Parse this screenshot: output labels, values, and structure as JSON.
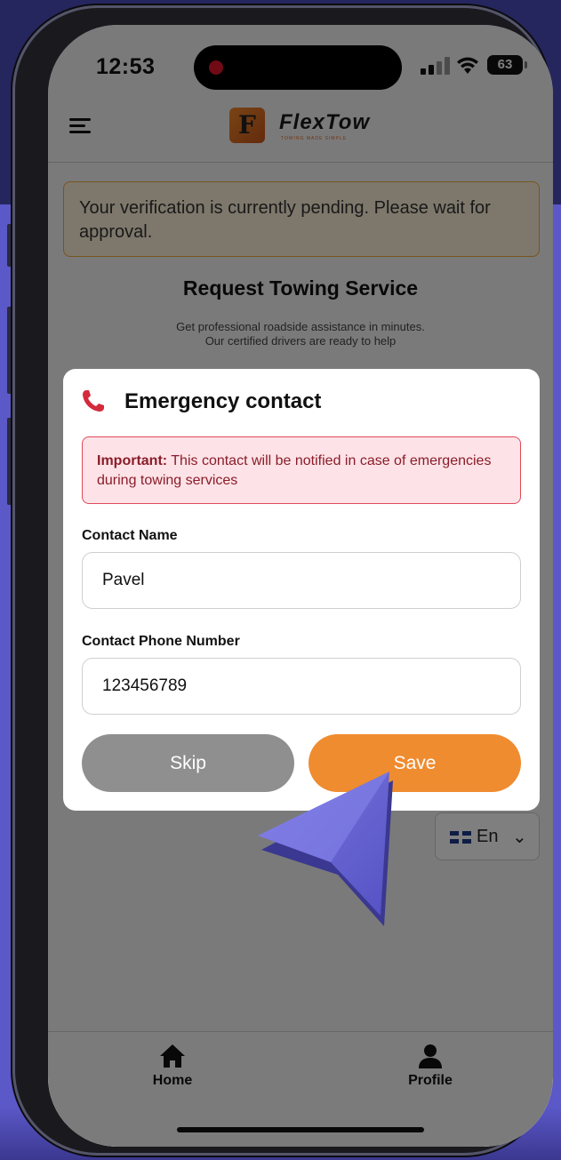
{
  "status_bar": {
    "time": "12:53",
    "battery": "63"
  },
  "header": {
    "brand": "FlexTow",
    "tagline": "TOWING MADE SIMPLE",
    "logo_letter": "F"
  },
  "notice": {
    "text": "Your verification is currently pending. Please wait for approval."
  },
  "page": {
    "title": "Request Towing Service",
    "subtitle_line1": "Get professional roadside assistance in minutes.",
    "subtitle_line2": "Our certified drivers are ready to help"
  },
  "language": {
    "selected": "En"
  },
  "modal": {
    "title": "Emergency contact",
    "alert_strong": "Important:",
    "alert_text": " This contact will be notified in case of emergencies during towing services",
    "name_label": "Contact Name",
    "name_value": "Pavel",
    "phone_label": "Contact Phone Number",
    "phone_value": "123456789",
    "skip_label": "Skip",
    "save_label": "Save"
  },
  "tabbar": {
    "home_label": "Home",
    "profile_label": "Profile"
  },
  "colors": {
    "accent": "#ef8c30",
    "danger": "#e04a5a",
    "backdrop": "#5b58c8"
  }
}
